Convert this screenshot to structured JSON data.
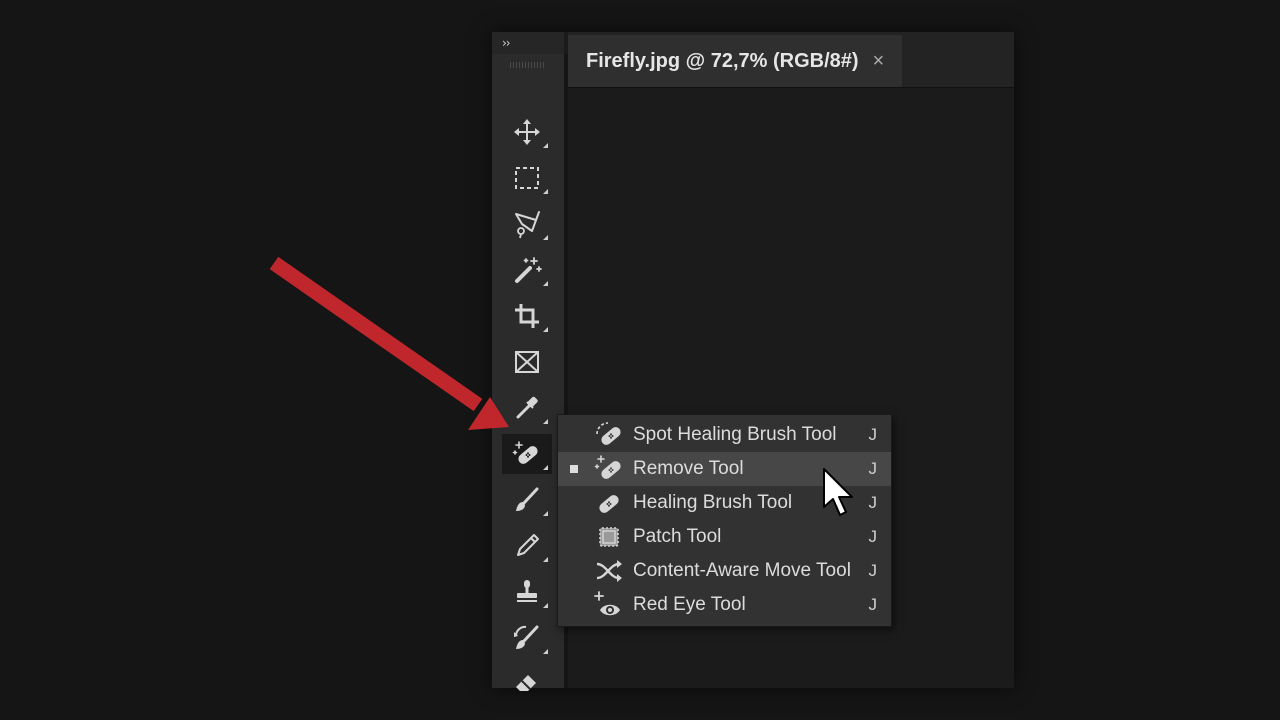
{
  "toolbar": {
    "collapse_label": "››",
    "tools": [
      {
        "icon": "move-icon"
      },
      {
        "icon": "rectangular-marquee-icon"
      },
      {
        "icon": "polygonal-lasso-icon"
      },
      {
        "icon": "magic-wand-icon"
      },
      {
        "icon": "crop-icon"
      },
      {
        "icon": "frame-icon"
      },
      {
        "icon": "eyedropper-icon"
      },
      {
        "icon": "remove-tool-icon",
        "active": true
      },
      {
        "icon": "brush-icon"
      },
      {
        "icon": "pencil-icon"
      },
      {
        "icon": "clone-stamp-icon"
      },
      {
        "icon": "history-brush-icon"
      },
      {
        "icon": "eraser-icon"
      }
    ]
  },
  "document": {
    "tab_title": "Firefly.jpg @ 72,7% (RGB/8#)",
    "close_glyph": "×"
  },
  "flyout": {
    "items": [
      {
        "label": "Spot Healing Brush Tool",
        "shortcut": "J",
        "icon": "spot-healing-brush-icon",
        "selected": false
      },
      {
        "label": "Remove Tool",
        "shortcut": "J",
        "icon": "remove-tool-icon",
        "selected": true
      },
      {
        "label": "Healing Brush Tool",
        "shortcut": "J",
        "icon": "healing-brush-icon",
        "selected": false
      },
      {
        "label": "Patch Tool",
        "shortcut": "J",
        "icon": "patch-icon",
        "selected": false
      },
      {
        "label": "Content-Aware Move Tool",
        "shortcut": "J",
        "icon": "content-aware-move-icon",
        "selected": false
      },
      {
        "label": "Red Eye Tool",
        "shortcut": "J",
        "icon": "red-eye-icon",
        "selected": false
      }
    ]
  },
  "colors": {
    "arrow": "#c0272d",
    "icon": "#d6d6d6"
  }
}
